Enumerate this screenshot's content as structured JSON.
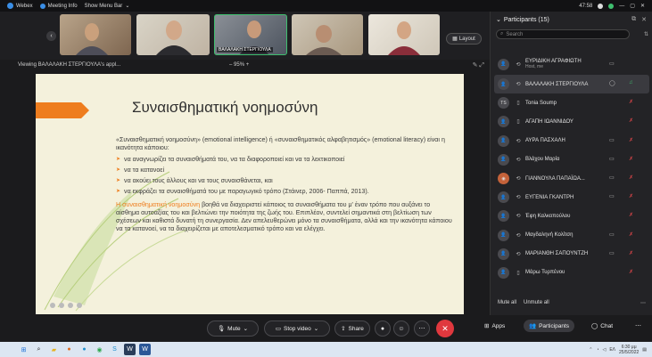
{
  "topbar": {
    "app_name": "Webex",
    "meeting_info": "Meeting Info",
    "show_menu_bar": "Show Menu Bar",
    "time": "47:58"
  },
  "strip": {
    "thumbnails": [
      {
        "label": ""
      },
      {
        "label": ""
      },
      {
        "label": "ΒΑΛΑΛΑΚΗ ΣΤΕΡΓΙΟΥΛΑ"
      },
      {
        "label": ""
      },
      {
        "label": ""
      }
    ],
    "layout_label": "Layout"
  },
  "viewbar": {
    "viewing_text": "Viewing ΒΑΛΑΛΑΚΗ ΣΤΕΡΓΙΟΥΛΑ's appl...",
    "zoom_text": "95%"
  },
  "slide": {
    "title": "Συναισθηματική νοημοσύνη",
    "intro": "«Συναισθηματική νοημοσύνη» (emotional intelligence) ή «συναισθηματικός αλφαβητισμός» (emotional literacy) είναι η ικανότητα κάποιου:",
    "bullets": [
      "να αναγνωρίζει τα συναισθήματά του, να τα διαφοροποιεί και να τα λεκτικοποιεί",
      "να τα κατανοεί",
      "να ακούει τους άλλους και να τους συναισθάνεται, και",
      "να εκφράζει τα συναισθήματά του με παραγωγικό τρόπο (Στάινερ, 2006- Παππά, 2013)."
    ],
    "para2_highlight": "Η συναισθηματική νοημοσύνη",
    "para2_rest": " βοηθά να διαχειριστεί κάποιος τα συναισθήματα του μ' έναν τρόπο που αυξάνει το αίσθημα αυτοαξίας του και βελτιώνει την ποιότητα της ζωής του. Επιπλέον, συντελεί σημαντικά στη βελτίωση των σχέσεων και καθιστά δυνατή τη συνεργασία. Δεν απελευθερώνει μόνο τα συναισθήματα, αλλά και την ικανότητα κάποιου να τα κατανοεί, να τα διαχειρίζεται με αποτελεσματικό τρόπο και να ελέγχει."
  },
  "panel": {
    "title": "Participants (15)",
    "search_placeholder": "Search",
    "participants": [
      {
        "name": "ΕΥΡΙΔΙΚΗ ΑΓΡΑΦΙΩΤΗ",
        "sub": "Host, me",
        "avatar": "",
        "cam": "video",
        "mic": "muted"
      },
      {
        "name": "ΒΑΛΑΛΑΚΗ ΣΤΕΡΓΙΟΥΛΑ",
        "sub": "",
        "avatar": "",
        "cam": "chat",
        "mic": "on"
      },
      {
        "name": "Tonia Soump",
        "sub": "",
        "avatar": "TS",
        "cam": "",
        "mic": "muted"
      },
      {
        "name": "ΑΓΑΠΗ ΙΩΑΝΝΙΔΟΥ",
        "sub": "",
        "avatar": "",
        "cam": "",
        "mic": "muted"
      },
      {
        "name": "ΑΥΡΑ ΠΑΣΧΑΛΗ",
        "sub": "",
        "avatar": "",
        "cam": "video",
        "mic": "muted"
      },
      {
        "name": "Βλάχου Μαρία",
        "sub": "",
        "avatar": "",
        "cam": "video",
        "mic": "muted"
      },
      {
        "name": "ΓΙΑΝΝΟΥΛΑ ΠΑΠΑΪΩΑ...",
        "sub": "",
        "avatar": "photo",
        "cam": "video",
        "mic": "muted"
      },
      {
        "name": "ΕΥΓΕΝΙΑ ΓΚΑΝΤΡΗ",
        "sub": "",
        "avatar": "",
        "cam": "video",
        "mic": "muted"
      },
      {
        "name": "Έφη Καλκοπούλου",
        "sub": "",
        "avatar": "",
        "cam": "",
        "mic": "muted"
      },
      {
        "name": "Μαγδαληνή Κολίτση",
        "sub": "",
        "avatar": "",
        "cam": "video",
        "mic": "muted"
      },
      {
        "name": "ΜΑΡΙΑΝΘΗ ΣΑΠΟΥΝΤΖΗ",
        "sub": "",
        "avatar": "",
        "cam": "video",
        "mic": "muted"
      },
      {
        "name": "Μάρω Τυρπένου",
        "sub": "",
        "avatar": "",
        "cam": "",
        "mic": "muted"
      }
    ],
    "mute_all": "Mute all",
    "unmute_all": "Unmute all"
  },
  "controls": {
    "mute": "Mute",
    "stop_video": "Stop video",
    "share": "Share",
    "apps": "Apps",
    "participants": "Participants",
    "chat": "Chat"
  },
  "taskbar": {
    "lang": "ΕΛ",
    "time": "6:30 μμ",
    "date": "25/5/2022"
  },
  "colors": {
    "accent_orange": "#ee7d1e",
    "mic_muted": "#e0464a",
    "mic_on": "#3fbf6f",
    "end_call": "#e0383e"
  }
}
